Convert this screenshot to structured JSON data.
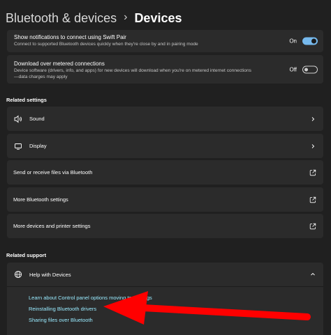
{
  "header": {
    "parent": "Bluetooth & devices",
    "separator": "›",
    "current": "Devices"
  },
  "settings": {
    "swift_pair": {
      "title": "Show notifications to connect using Swift Pair",
      "desc": "Connect to supported Bluetooth devices quickly when they're close by and in pairing mode",
      "state": "On"
    },
    "metered": {
      "title": "Download over metered connections",
      "desc": "Device software (drivers, info, and apps) for new devices will download when you're on metered internet connections",
      "desc2": "—data charges may apply",
      "state": "Off"
    }
  },
  "related_settings": {
    "heading": "Related settings",
    "items": [
      {
        "label": "Sound",
        "icon": "speaker-icon",
        "trail": "chevron-right"
      },
      {
        "label": "Display",
        "icon": "monitor-icon",
        "trail": "chevron-right"
      },
      {
        "label": "Send or receive files via Bluetooth",
        "icon": "",
        "trail": "external-link"
      },
      {
        "label": "More Bluetooth settings",
        "icon": "",
        "trail": "external-link"
      },
      {
        "label": "More devices and printer settings",
        "icon": "",
        "trail": "external-link"
      }
    ]
  },
  "related_support": {
    "heading": "Related support",
    "expander_title": "Help with Devices",
    "links": [
      "Learn about Control panel options moving to Settings",
      "Reinstalling Bluetooth drivers",
      "Sharing files over Bluetooth"
    ]
  },
  "colors": {
    "background": "#202020",
    "card": "#2b2b2b",
    "accent": "#76b9ed",
    "link": "#99ebff",
    "annotation_arrow": "#ff0000"
  }
}
